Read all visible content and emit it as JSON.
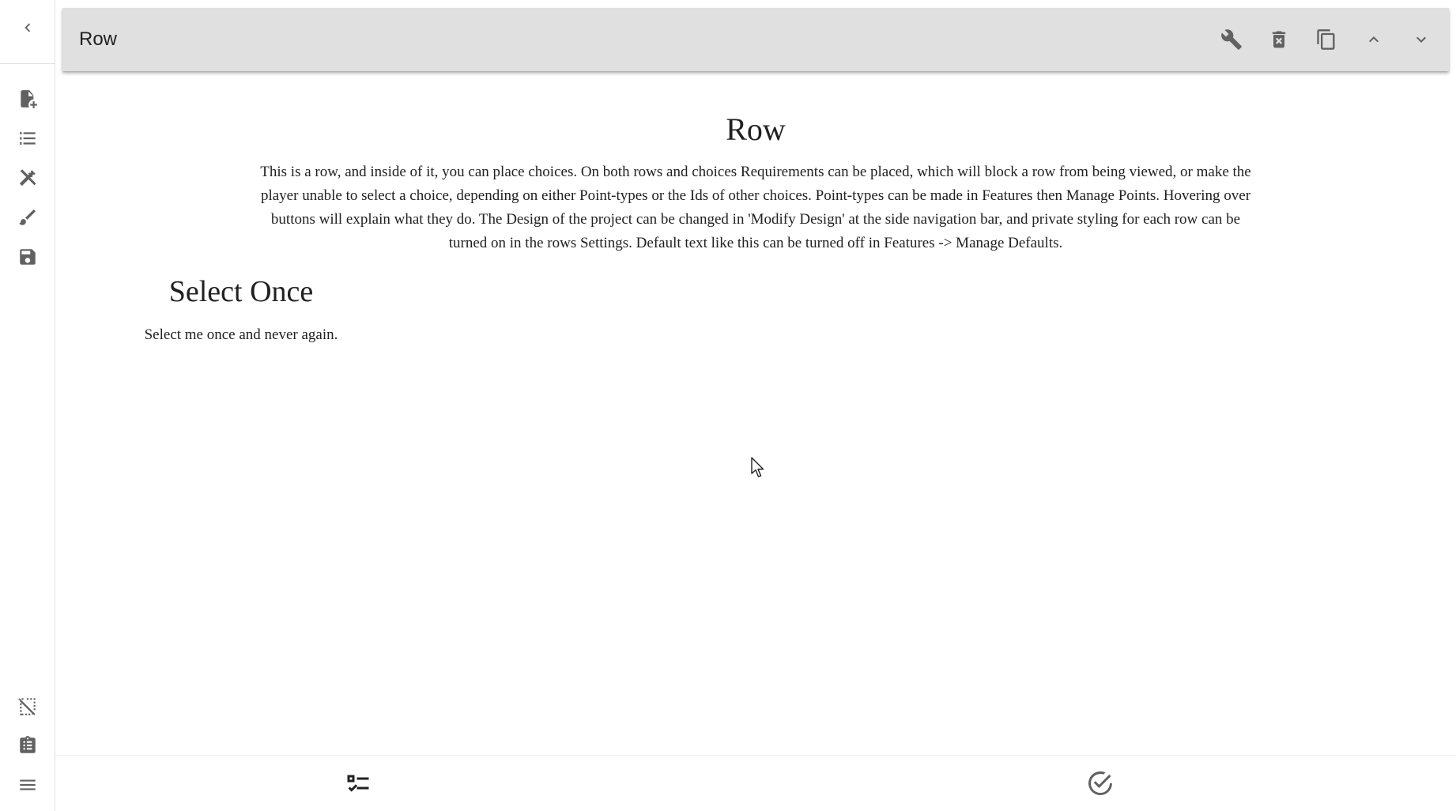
{
  "rail": {
    "top_icons": [
      "chevron-left-icon"
    ],
    "nav_icons": [
      "file-add-icon",
      "list-icon",
      "tools-icon",
      "brush-icon",
      "save-icon"
    ],
    "bottom_icons": [
      "select-off-icon",
      "clipboard-list-icon",
      "menu-icon"
    ]
  },
  "toolbar": {
    "title": "Row",
    "icons": [
      "wrench-icon",
      "delete-icon",
      "copy-icon",
      "chevron-up-icon",
      "chevron-down-icon"
    ]
  },
  "row": {
    "title": "Row",
    "text": "This is a row, and inside of it, you can place choices. On both rows and choices Requirements can be placed, which will block a row from being viewed, or make the player unable to select a choice, depending on either Point-types or the Ids of other choices. Point-types can be made in Features then Manage Points. Hovering over buttons will explain what they do. The Design of the project can be changed in 'Modify Design' at the side navigation bar, and private styling for each row can be turned on in the rows Settings. Default text like this can be turned off in Features -> Manage Defaults."
  },
  "choice": {
    "title": "Select Once",
    "text": "Select me once and never again."
  },
  "bottom_bar": {
    "icons": [
      "format-list-checks-icon",
      "check-circle-outline-icon"
    ]
  },
  "colors": {
    "toolbar_bg": "#e0e0e0",
    "icon": "#616161",
    "text": "#212121"
  }
}
